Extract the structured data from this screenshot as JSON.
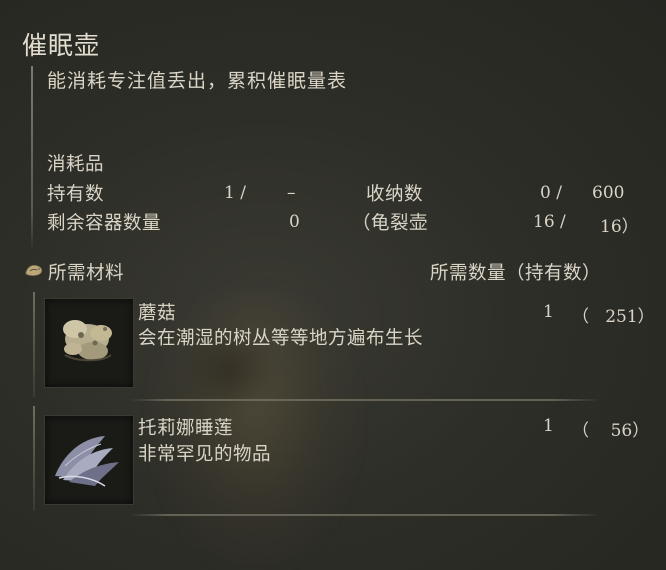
{
  "item": {
    "name": "催眠壶",
    "description": "能消耗专注值丢出，累积催眠量表"
  },
  "stats": {
    "category": "消耗品",
    "held_label": "持有数",
    "held_value": "1 /",
    "held_max": "–",
    "storage_label": "收纳数",
    "storage_value": "0 /",
    "storage_max": "600",
    "containers_label": "剩余容器数量",
    "containers_value": "0",
    "cracked_pot_label": "（龟裂壶",
    "cracked_pot_value": "16 /",
    "cracked_pot_max": "16）"
  },
  "materials": {
    "header_label": "所需材料",
    "quantity_header": "所需数量（持有数）",
    "items": [
      {
        "name": "蘑菇",
        "description": "会在潮湿的树丛等等地方遍布生长",
        "required": "1",
        "owned": "（   251）",
        "icon": "mushroom-icon"
      },
      {
        "name": "托莉娜睡莲",
        "description": "非常罕见的物品",
        "required": "1",
        "owned": "（    56）",
        "icon": "trina-lily-icon"
      }
    ]
  },
  "colors": {
    "text": "#d9d4c6",
    "background": "#2e2e28",
    "divider": "#7d7a6c"
  }
}
